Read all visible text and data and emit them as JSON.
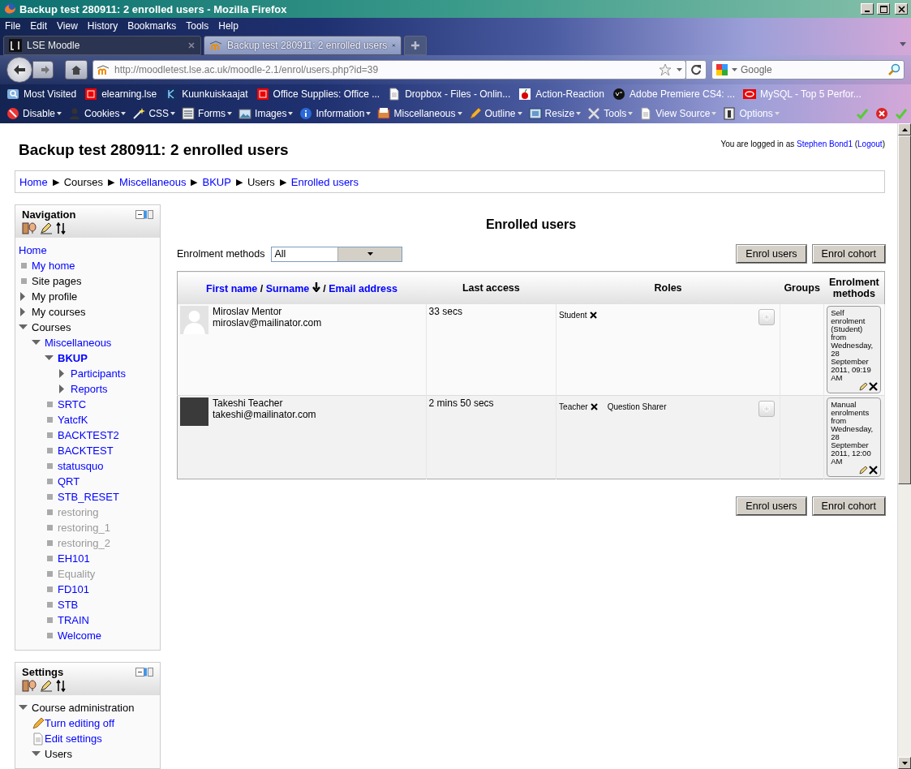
{
  "window": {
    "title": "Backup test 280911: 2 enrolled users - Mozilla Firefox"
  },
  "menu": [
    "File",
    "Edit",
    "View",
    "History",
    "Bookmarks",
    "Tools",
    "Help"
  ],
  "tabs": [
    {
      "label": "LSE Moodle",
      "kind": "lse",
      "selected": false
    },
    {
      "label": "Backup test 280911: 2 enrolled users",
      "kind": "moodle",
      "selected": true
    }
  ],
  "address": {
    "value": "http://moodletest.lse.ac.uk/moodle-2.1/enrol/users.php?id=39"
  },
  "search": {
    "placeholder": "Google"
  },
  "bookmarks": [
    {
      "label": "Most Visited",
      "kind": "magnifier"
    },
    {
      "label": "elearning.lse",
      "kind": "red-logo"
    },
    {
      "label": "Kuunkuiskaajat",
      "kind": "blue-logo"
    },
    {
      "label": "Office Supplies: Office ...",
      "kind": "red-logo"
    },
    {
      "label": "Dropbox - Files - Onlin...",
      "kind": "page"
    },
    {
      "label": "Action-Reaction",
      "kind": "cherry"
    },
    {
      "label": "Adobe Premiere CS4: ...",
      "kind": "black-circle"
    },
    {
      "label": "MySQL - Top 5 Perfor...",
      "kind": "red-oval"
    }
  ],
  "devtools": [
    {
      "label": "Disable",
      "kind": "no-entry"
    },
    {
      "label": "Cookies",
      "kind": "person"
    },
    {
      "label": "CSS",
      "kind": "wand"
    },
    {
      "label": "Forms",
      "kind": "form"
    },
    {
      "label": "Images",
      "kind": "image"
    },
    {
      "label": "Information",
      "kind": "info"
    },
    {
      "label": "Miscellaneous",
      "kind": "tray"
    },
    {
      "label": "Outline",
      "kind": "pencil"
    },
    {
      "label": "Resize",
      "kind": "resize"
    },
    {
      "label": "Tools",
      "kind": "tools"
    },
    {
      "label": "View Source",
      "kind": "page"
    },
    {
      "label": "Options",
      "kind": "options"
    }
  ],
  "status_icons": [
    {
      "kind": "check"
    },
    {
      "kind": "error"
    },
    {
      "kind": "check"
    }
  ],
  "page": {
    "heading": "Backup test 280911: 2 enrolled users",
    "login": [
      {
        "text": "You are logged in as ",
        "link": false
      },
      {
        "text": "Stephen Bond1",
        "link": true
      },
      {
        "text": " (",
        "link": false
      },
      {
        "text": "Logout",
        "link": true
      },
      {
        "text": ")",
        "link": false
      }
    ],
    "breadcrumb": [
      {
        "label": "Home",
        "link": true,
        "separator": "▶"
      },
      {
        "label": "Courses",
        "link": false,
        "separator": "▶"
      },
      {
        "label": "Miscellaneous",
        "link": true,
        "separator": "▶"
      },
      {
        "label": "BKUP",
        "link": true,
        "separator": "▶"
      },
      {
        "label": "Users",
        "link": false,
        "separator": "▶"
      },
      {
        "label": "Enrolled users",
        "link": true
      }
    ]
  },
  "navigation": {
    "title": "Navigation",
    "items": [
      {
        "label": "Home",
        "kind": "none",
        "link": true,
        "dimmed": false,
        "current": false
      },
      {
        "label": "My home",
        "kind": "bullet",
        "link": true,
        "dimmed": false,
        "current": false
      },
      {
        "label": "Site pages",
        "kind": "bullet",
        "link": false,
        "dimmed": false,
        "current": false
      },
      {
        "label": "My profile",
        "kind": "branch",
        "expanded": false,
        "link": false,
        "dimmed": false,
        "current": false
      },
      {
        "label": "My courses",
        "kind": "branch",
        "expanded": false,
        "link": false,
        "dimmed": false,
        "current": false
      },
      {
        "label": "Courses",
        "kind": "branch",
        "expanded": true,
        "link": false,
        "dimmed": false,
        "current": false,
        "children": [
          {
            "label": "Miscellaneous",
            "kind": "branch",
            "expanded": true,
            "link": true,
            "dimmed": false,
            "current": false,
            "children": [
              {
                "label": "BKUP",
                "kind": "branch",
                "expanded": true,
                "link": true,
                "dimmed": false,
                "current": true,
                "children": [
                  {
                    "label": "Participants",
                    "kind": "branch",
                    "expanded": false,
                    "link": true,
                    "dimmed": false,
                    "current": false
                  },
                  {
                    "label": "Reports",
                    "kind": "branch",
                    "expanded": false,
                    "link": true,
                    "dimmed": false,
                    "current": false
                  }
                ]
              },
              {
                "label": "SRTC",
                "kind": "bullet",
                "link": true,
                "dimmed": false,
                "current": false
              },
              {
                "label": "YatcfK",
                "kind": "bullet",
                "link": true,
                "dimmed": false,
                "current": false
              },
              {
                "label": "BACKTEST2",
                "kind": "bullet",
                "link": true,
                "dimmed": false,
                "current": false
              },
              {
                "label": "BACKTEST",
                "kind": "bullet",
                "link": true,
                "dimmed": false,
                "current": false
              },
              {
                "label": "statusquo",
                "kind": "bullet",
                "link": true,
                "dimmed": false,
                "current": false
              },
              {
                "label": "QRT",
                "kind": "bullet",
                "link": true,
                "dimmed": false,
                "current": false
              },
              {
                "label": "STB_RESET",
                "kind": "bullet",
                "link": true,
                "dimmed": false,
                "current": false
              },
              {
                "label": "restoring",
                "kind": "bullet",
                "link": true,
                "dimmed": true,
                "current": false
              },
              {
                "label": "restoring_1",
                "kind": "bullet",
                "link": true,
                "dimmed": true,
                "current": false
              },
              {
                "label": "restoring_2",
                "kind": "bullet",
                "link": true,
                "dimmed": true,
                "current": false
              },
              {
                "label": "EH101",
                "kind": "bullet",
                "link": true,
                "dimmed": false,
                "current": false
              },
              {
                "label": "Equality",
                "kind": "bullet",
                "link": true,
                "dimmed": true,
                "current": false
              },
              {
                "label": "FD101",
                "kind": "bullet",
                "link": true,
                "dimmed": false,
                "current": false
              },
              {
                "label": "STB",
                "kind": "bullet",
                "link": true,
                "dimmed": false,
                "current": false
              },
              {
                "label": "TRAIN",
                "kind": "bullet",
                "link": true,
                "dimmed": false,
                "current": false
              },
              {
                "label": "Welcome",
                "kind": "bullet",
                "link": true,
                "dimmed": false,
                "current": false
              }
            ]
          }
        ]
      }
    ]
  },
  "settings": {
    "title": "Settings",
    "items": [
      {
        "label": "Course administration",
        "kind": "branch",
        "expanded": true,
        "link": false,
        "dimmed": false,
        "current": false,
        "children": [
          {
            "label": "Turn editing off",
            "kind": "pencil",
            "link": true,
            "dimmed": false,
            "current": false
          },
          {
            "label": "Edit settings",
            "kind": "document",
            "link": true,
            "dimmed": false,
            "current": false
          },
          {
            "label": "Users",
            "kind": "branch",
            "expanded": true,
            "link": false,
            "dimmed": false,
            "current": false
          }
        ]
      }
    ]
  },
  "enrolled": {
    "title": "Enrolled users",
    "filter": {
      "label": "Enrolment methods",
      "value": "All"
    },
    "buttons": [
      "Enrol users",
      "Enrol cohort"
    ],
    "bottom_buttons": [
      "Enrol users",
      "Enrol cohort"
    ],
    "columns": [
      {
        "parts": [
          {
            "text": "First name",
            "kind": "link"
          },
          {
            "text": "/",
            "kind": "text"
          },
          {
            "text": "Surname",
            "kind": "link"
          },
          {
            "kind": "sort-icon"
          },
          {
            "text": "/",
            "kind": "text"
          },
          {
            "text": "Email address",
            "kind": "link"
          }
        ]
      },
      {
        "parts": [
          {
            "text": "Last access",
            "kind": "text"
          }
        ]
      },
      {
        "parts": [
          {
            "text": "Roles",
            "kind": "text"
          }
        ]
      },
      {
        "parts": [
          {
            "text": "Groups",
            "kind": "text"
          }
        ]
      },
      {
        "parts": [
          {
            "text": "Enrolment methods",
            "kind": "text"
          }
        ]
      }
    ],
    "rows": [
      {
        "name": "Miroslav Mentor",
        "email": "miroslav@mailinator.com",
        "avatar": {
          "kind": "silhouette"
        },
        "last_access": "33 secs",
        "roles": [
          {
            "label": "Student",
            "removable": true
          }
        ],
        "enrolment": "Self enrolment (Student) from Wednesday, 28 September 2011, 09:19 AM"
      },
      {
        "name": "Takeshi Teacher",
        "email": "takeshi@mailinator.com",
        "avatar": {
          "kind": "photo"
        },
        "last_access": "2 mins 50 secs",
        "roles": [
          {
            "label": "Teacher",
            "removable": true
          },
          {
            "label": "Question Sharer",
            "removable": false
          }
        ],
        "enrolment": "Manual enrolments from Wednesday, 28 September 2011, 12:00 AM"
      }
    ]
  }
}
